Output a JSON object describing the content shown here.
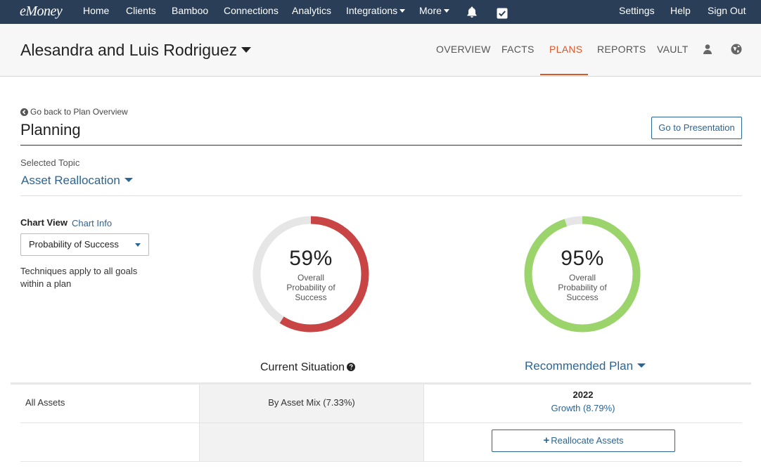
{
  "topnav": {
    "logo": "eMoney",
    "items": [
      "Home",
      "Clients",
      "Bamboo",
      "Connections",
      "Analytics",
      "Integrations",
      "More"
    ],
    "right": [
      "Settings",
      "Help",
      "Sign Out"
    ],
    "icons": [
      "bell-icon",
      "checkbox-icon"
    ]
  },
  "client": {
    "name": "Alesandra and Luis Rodriguez",
    "tabs": [
      "OVERVIEW",
      "FACTS",
      "PLANS",
      "REPORTS",
      "VAULT"
    ],
    "active_tab": "PLANS",
    "icons": [
      "user-icon",
      "globe-icon"
    ]
  },
  "planning": {
    "back_link": "Go back to Plan Overview",
    "title": "Planning",
    "presentation_button": "Go to Presentation",
    "selected_topic_label": "Selected Topic",
    "selected_topic": "Asset Reallocation"
  },
  "chart_view": {
    "label": "Chart View",
    "info_link": "Chart Info",
    "selected": "Probability of Success",
    "note": "Techniques apply to all goals within a plan"
  },
  "current": {
    "percent": 59,
    "percent_label": "59%",
    "sub_line1": "Overall",
    "sub_line2": "Probability of",
    "sub_line3": "Success",
    "color": "#c94444",
    "title": "Current Situation"
  },
  "recommended": {
    "percent": 95,
    "percent_label": "95%",
    "sub_line1": "Overall",
    "sub_line2": "Probability of",
    "sub_line3": "Success",
    "color": "#9ad46a",
    "title": "Recommended Plan"
  },
  "table": {
    "row_label": "All Assets",
    "current_value": "By Asset Mix (7.33%)",
    "year": "2022",
    "recommended_value": "Growth (8.79%)",
    "reallocate_button": "Reallocate Assets"
  },
  "colors": {
    "nav_bg": "#2a3e57",
    "accent": "#d9582b",
    "link": "#2b6594",
    "track": "#e6e6e6"
  }
}
